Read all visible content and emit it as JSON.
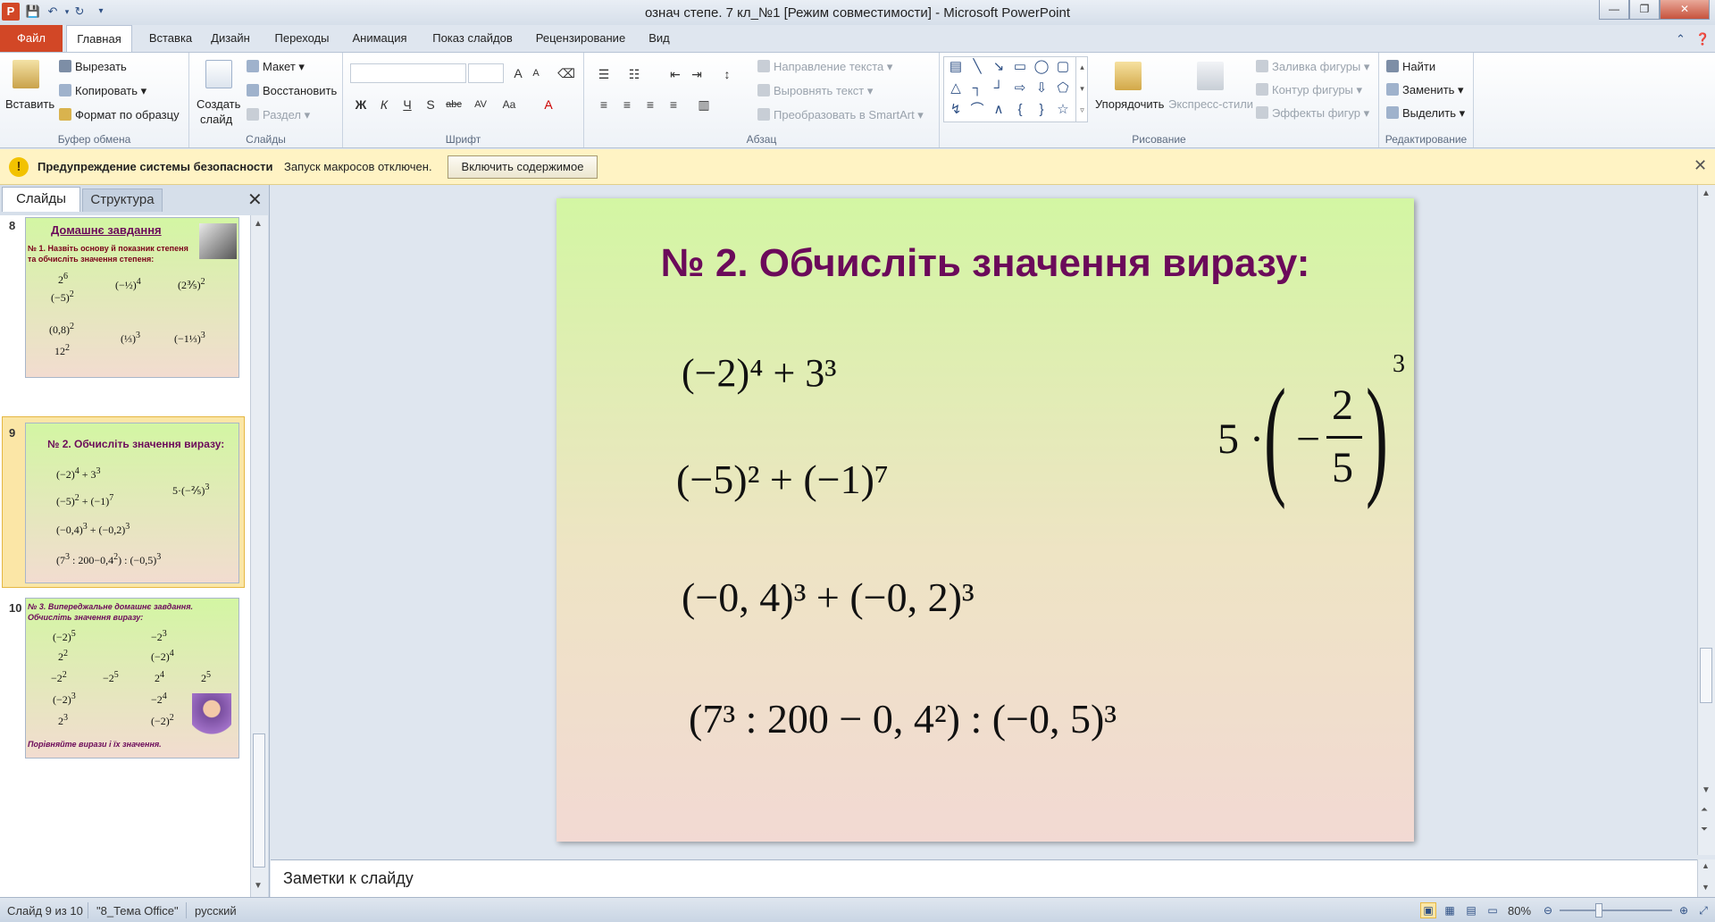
{
  "window": {
    "title": "означ степе. 7 кл_№1 [Режим совместимости] - Microsoft PowerPoint",
    "minimize_label": "—",
    "maximize_label": "❐",
    "close_label": "✕"
  },
  "quick_access": {
    "save_icon": "save-icon",
    "undo_icon": "undo-icon",
    "redo_icon": "redo-icon",
    "customize_icon": "customize-icon"
  },
  "ribbon_tabs": {
    "file": "Файл",
    "home": "Главная",
    "insert": "Вставка",
    "design": "Дизайн",
    "transitions": "Переходы",
    "animation": "Анимация",
    "slideshow": "Показ слайдов",
    "review": "Рецензирование",
    "view": "Вид"
  },
  "ribbon": {
    "clipboard": {
      "label": "Буфер обмена",
      "paste": "Вставить",
      "cut": "Вырезать",
      "copy": "Копировать",
      "format_painter": "Формат по образцу"
    },
    "slides": {
      "label": "Слайды",
      "new_slide_line1": "Создать",
      "new_slide_line2": "слайд",
      "layout": "Макет",
      "reset": "Восстановить",
      "section": "Раздел"
    },
    "font": {
      "label": "Шрифт",
      "family_value": "",
      "size_value": ""
    },
    "paragraph": {
      "label": "Абзац",
      "text_direction": "Направление текста",
      "align_text": "Выровнять текст",
      "smartart": "Преобразовать в SmartArt"
    },
    "drawing": {
      "label": "Рисование",
      "arrange": "Упорядочить",
      "quick_styles": "Экспресс-стили",
      "shape_fill": "Заливка фигуры",
      "shape_outline": "Контур фигуры",
      "shape_effects": "Эффекты фигур"
    },
    "editing": {
      "label": "Редактирование",
      "find": "Найти",
      "replace": "Заменить",
      "select": "Выделить"
    }
  },
  "security_bar": {
    "title": "Предупреждение системы безопасности",
    "message": "Запуск макросов отключен.",
    "button": "Включить содержимое"
  },
  "panel": {
    "tab_slides": "Слайды",
    "tab_outline": "Структура"
  },
  "thumbnails": [
    {
      "number": "8",
      "title": "Домашнє завдання",
      "subtitle": "№ 1. Назвіть основу й показник степеня та обчисліть значення степеня:"
    },
    {
      "number": "9",
      "title": "№ 2. Обчисліть  значення  виразу:"
    },
    {
      "number": "10",
      "title": "№ 3. Випереджальне домашнє завдання. Обчисліть значення виразу:",
      "footer": "Порівняйте вирази і їх значення."
    }
  ],
  "slide": {
    "title": "№ 2. Обчисліть значення виразу:",
    "expr1": "(−2)⁴ + 3³",
    "expr2": "(−5)² + (−1)⁷",
    "expr3": "(−0, 4)³ + (−0, 2)³",
    "expr4": "(7³ : 200 − 0, 4²) : (−0, 5)³",
    "expr5": {
      "coef": "5 ·",
      "minus": "−",
      "numerator": "2",
      "denominator": "5",
      "exponent": "3"
    }
  },
  "notes": {
    "placeholder": "Заметки к слайду"
  },
  "status": {
    "slide_info": "Слайд 9 из 10",
    "theme": "\"8_Тема Office\"",
    "language": "русский",
    "zoom": "80%"
  },
  "colors": {
    "file_tab": "#d24726",
    "slide_title": "#6b0a5a",
    "security_bg": "#fff3c4"
  }
}
